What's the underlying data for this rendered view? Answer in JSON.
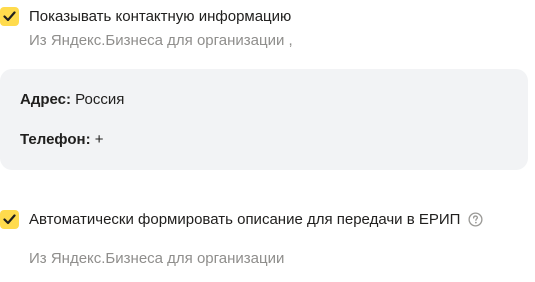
{
  "contact_section": {
    "checkbox_label": "Показывать контактную информацию",
    "checked": true,
    "source_text": "Из Яндекс.Бизнеса для организации",
    "source_suffix": ","
  },
  "contact_card": {
    "address_key": "Адрес:",
    "address_value": "Россия",
    "phone_key": "Телефон:",
    "phone_value": "+"
  },
  "description_section": {
    "checkbox_label": "Автоматически формировать описание для передачи в ЕРИП",
    "checked": true,
    "help_icon": "question-circle-icon",
    "source_text": "Из Яндекс.Бизнеса для организации"
  },
  "colors": {
    "checkbox_fill": "#ffdb4d",
    "card_background": "#f2f3f5",
    "secondary_text": "#8f8e8c"
  }
}
